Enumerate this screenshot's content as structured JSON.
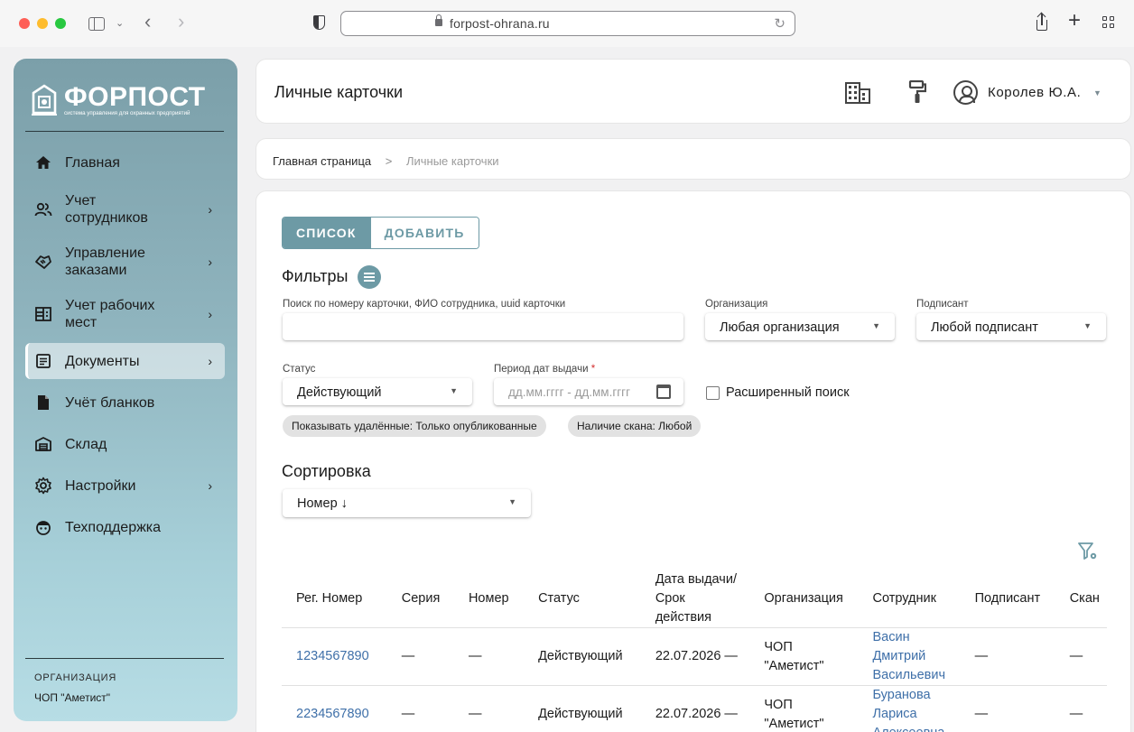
{
  "browser": {
    "url": "forpost-ohrana.ru"
  },
  "sidebar": {
    "logo_text": "ФОРПОСТ",
    "logo_subtitle": "система управления для охранных предприятий",
    "items": [
      {
        "label": "Главная",
        "icon": "home-icon",
        "has_chevron": false
      },
      {
        "label": "Учет сотрудников",
        "icon": "people-icon",
        "has_chevron": true
      },
      {
        "label": "Управление заказами",
        "icon": "handshake-icon",
        "has_chevron": true
      },
      {
        "label": "Учет рабочих мест",
        "icon": "workplace-icon",
        "has_chevron": true
      },
      {
        "label": "Документы",
        "icon": "document-icon",
        "has_chevron": true,
        "active": true
      },
      {
        "label": "Учёт бланков",
        "icon": "file-icon",
        "has_chevron": false
      },
      {
        "label": "Склад",
        "icon": "warehouse-icon",
        "has_chevron": false
      },
      {
        "label": "Настройки",
        "icon": "gear-icon",
        "has_chevron": true
      },
      {
        "label": "Техподдержка",
        "icon": "support-icon",
        "has_chevron": false
      }
    ],
    "org_caption": "ОРГАНИЗАЦИЯ",
    "org_value": "ЧОП \"Аметист\""
  },
  "header": {
    "title": "Личные карточки",
    "username": "Королев Ю.А."
  },
  "breadcrumb": {
    "home": "Главная страница",
    "separator": ">",
    "current": "Личные карточки"
  },
  "tabs": {
    "list": "СПИСОК",
    "add": "ДОБАВИТЬ"
  },
  "filters": {
    "title": "Фильтры",
    "search_label": "Поиск по номеру карточки, ФИО сотрудника, uuid карточки",
    "search_value": "",
    "org_label": "Организация",
    "org_value": "Любая организация",
    "signer_label": "Подписант",
    "signer_value": "Любой подписант",
    "status_label": "Статус",
    "status_value": "Действующий",
    "period_label": "Период дат выдачи",
    "period_required": "*",
    "period_placeholder": "дд.мм.гггг - дд.мм.гггг",
    "extended_search": "Расширенный поиск",
    "chips": [
      "Показывать удалённые: Только опубликованные",
      "Наличие скана: Любой"
    ]
  },
  "sort": {
    "title": "Сортировка",
    "value": "Номер ↓"
  },
  "table": {
    "headers": [
      "Рег. Номер",
      "Серия",
      "Номер",
      "Статус",
      "Дата выдачи/Срок действия",
      "Организация",
      "Сотрудник",
      "Подписант",
      "Скан"
    ],
    "rows": [
      {
        "reg": "1234567890",
        "series": "—",
        "number": "—",
        "status": "Действующий",
        "date": "22.07.2026 —",
        "org": "ЧОП \"Аметист\"",
        "employee": "Васин Дмитрий Васильевич",
        "signer": "—",
        "scan": "—"
      },
      {
        "reg": "2234567890",
        "series": "—",
        "number": "—",
        "status": "Действующий",
        "date": "22.07.2026 —",
        "org": "ЧОП \"Аметист\"",
        "employee": "Буранова Лариса Алексеевна",
        "signer": "—",
        "scan": "—"
      }
    ]
  },
  "colors": {
    "accent": "#6d9aa5",
    "link": "#3e6fa8",
    "sidebar_top": "#7b9fa9",
    "sidebar_bottom": "#b7dde5"
  }
}
